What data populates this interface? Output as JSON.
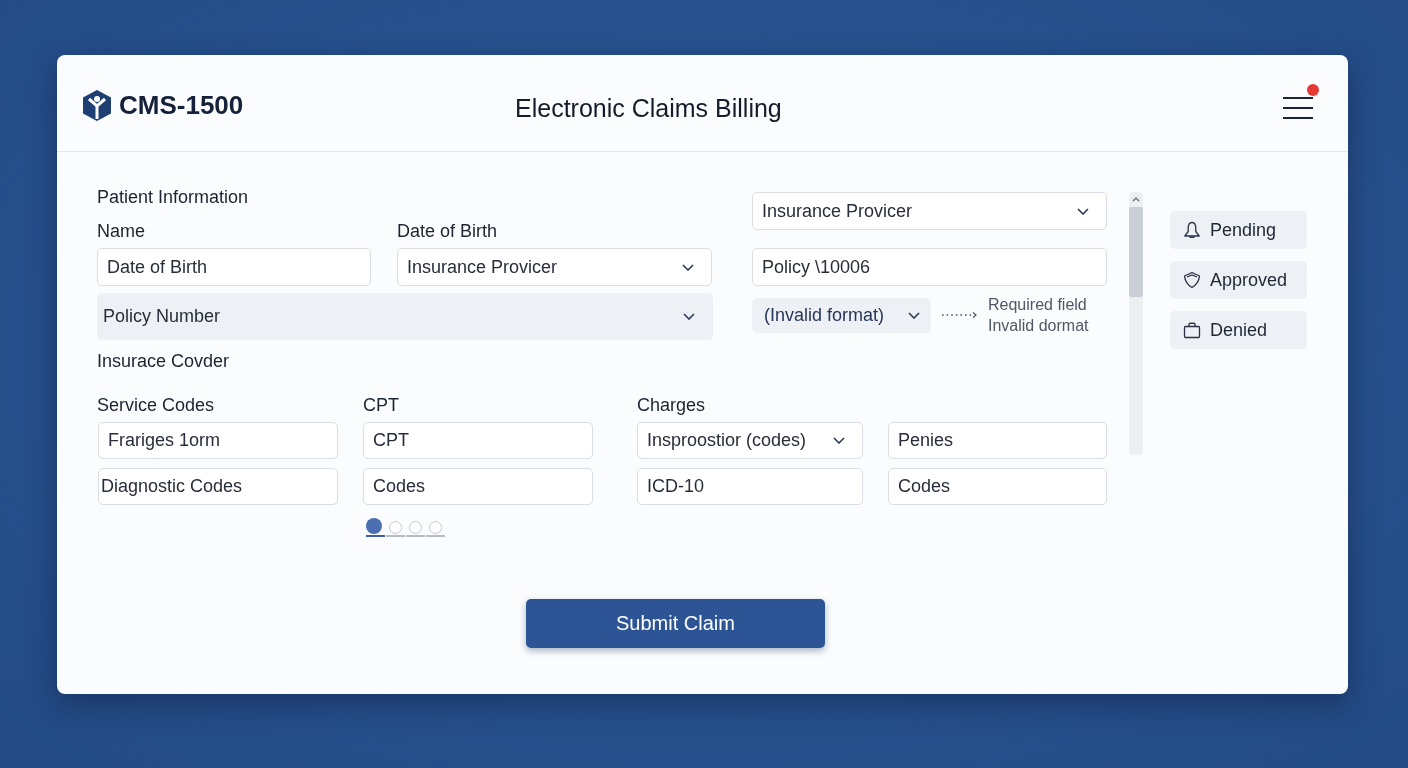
{
  "header": {
    "logo_text": "CMS-1500",
    "title": "Electronic Claims Billing",
    "menu": {
      "notification": true
    }
  },
  "patient_information": {
    "heading": "Patient Information",
    "columns": [
      {
        "label": "Name",
        "field": {
          "kind": "input",
          "value": "Date of Birth"
        }
      },
      {
        "label": "Date of Birth",
        "field": {
          "kind": "select",
          "value": "Insurance Provicer"
        }
      }
    ],
    "policy_field": {
      "kind": "select_shaded",
      "value": "Policy Number"
    },
    "subheading": "Insurace Covder"
  },
  "insurance": {
    "fields": [
      {
        "kind": "select",
        "value": "Insurance Provicer"
      },
      {
        "kind": "input",
        "value": "Policy \\10006"
      }
    ],
    "format_field": {
      "kind": "select_shaded",
      "value": "(Invalid format)"
    },
    "messages": [
      "Required field",
      "Invalid dormat"
    ]
  },
  "codes": {
    "columns": [
      {
        "label": "Service Codes",
        "fields": [
          {
            "kind": "input",
            "value": "Frariges 1orm"
          },
          {
            "kind": "input",
            "value": "Diagnostic Codes"
          }
        ]
      },
      {
        "label": "CPT",
        "fields": [
          {
            "kind": "input",
            "value": "CPT"
          },
          {
            "kind": "input",
            "value": "Codes"
          }
        ]
      },
      {
        "label": "Charges",
        "fields": [
          {
            "kind": "select",
            "value": "Insproostior (codes)"
          },
          {
            "kind": "input",
            "value": "ICD-10"
          }
        ]
      },
      {
        "fields": [
          {
            "kind": "input",
            "value": "Penies"
          },
          {
            "kind": "input",
            "value": "Codes"
          }
        ]
      }
    ]
  },
  "pagination": [
    {
      "selected": true
    },
    {
      "selected": false
    },
    {
      "selected": false
    },
    {
      "selected": false
    }
  ],
  "status_buttons": [
    {
      "kind": "pending",
      "label": "Pending"
    },
    {
      "kind": "approved",
      "label": "Approved"
    },
    {
      "kind": "denied",
      "label": "Denied"
    }
  ],
  "submit_button": "Submit Claim"
}
